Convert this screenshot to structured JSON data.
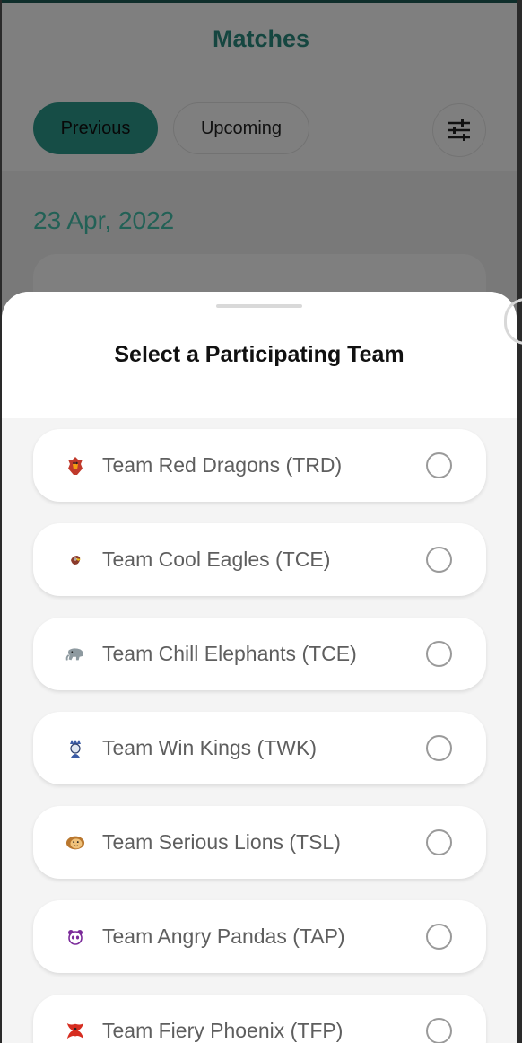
{
  "header": {
    "title": "Matches",
    "tabs": [
      {
        "label": "Previous",
        "active": true
      },
      {
        "label": "Upcoming",
        "active": false
      }
    ],
    "filter_icon": "sliders-icon"
  },
  "feed": {
    "date": "23 Apr, 2022"
  },
  "sheet": {
    "title": "Select a Participating Team",
    "teams": [
      {
        "name": "Team Red Dragons (TRD)",
        "icon": "dragon-icon",
        "selected": false
      },
      {
        "name": "Team Cool Eagles (TCE)",
        "icon": "eagle-icon",
        "selected": false
      },
      {
        "name": "Team Chill Elephants (TCE)",
        "icon": "elephant-icon",
        "selected": false
      },
      {
        "name": "Team Win Kings (TWK)",
        "icon": "king-icon",
        "selected": false
      },
      {
        "name": "Team Serious Lions (TSL)",
        "icon": "lion-icon",
        "selected": false
      },
      {
        "name": "Team Angry Pandas (TAP)",
        "icon": "panda-icon",
        "selected": false
      },
      {
        "name": "Team Fiery Phoenix (TFP)",
        "icon": "phoenix-icon",
        "selected": false
      }
    ]
  },
  "colors": {
    "accent": "#2d9a8c",
    "title": "#2b8d80",
    "date": "#45c3ad"
  }
}
